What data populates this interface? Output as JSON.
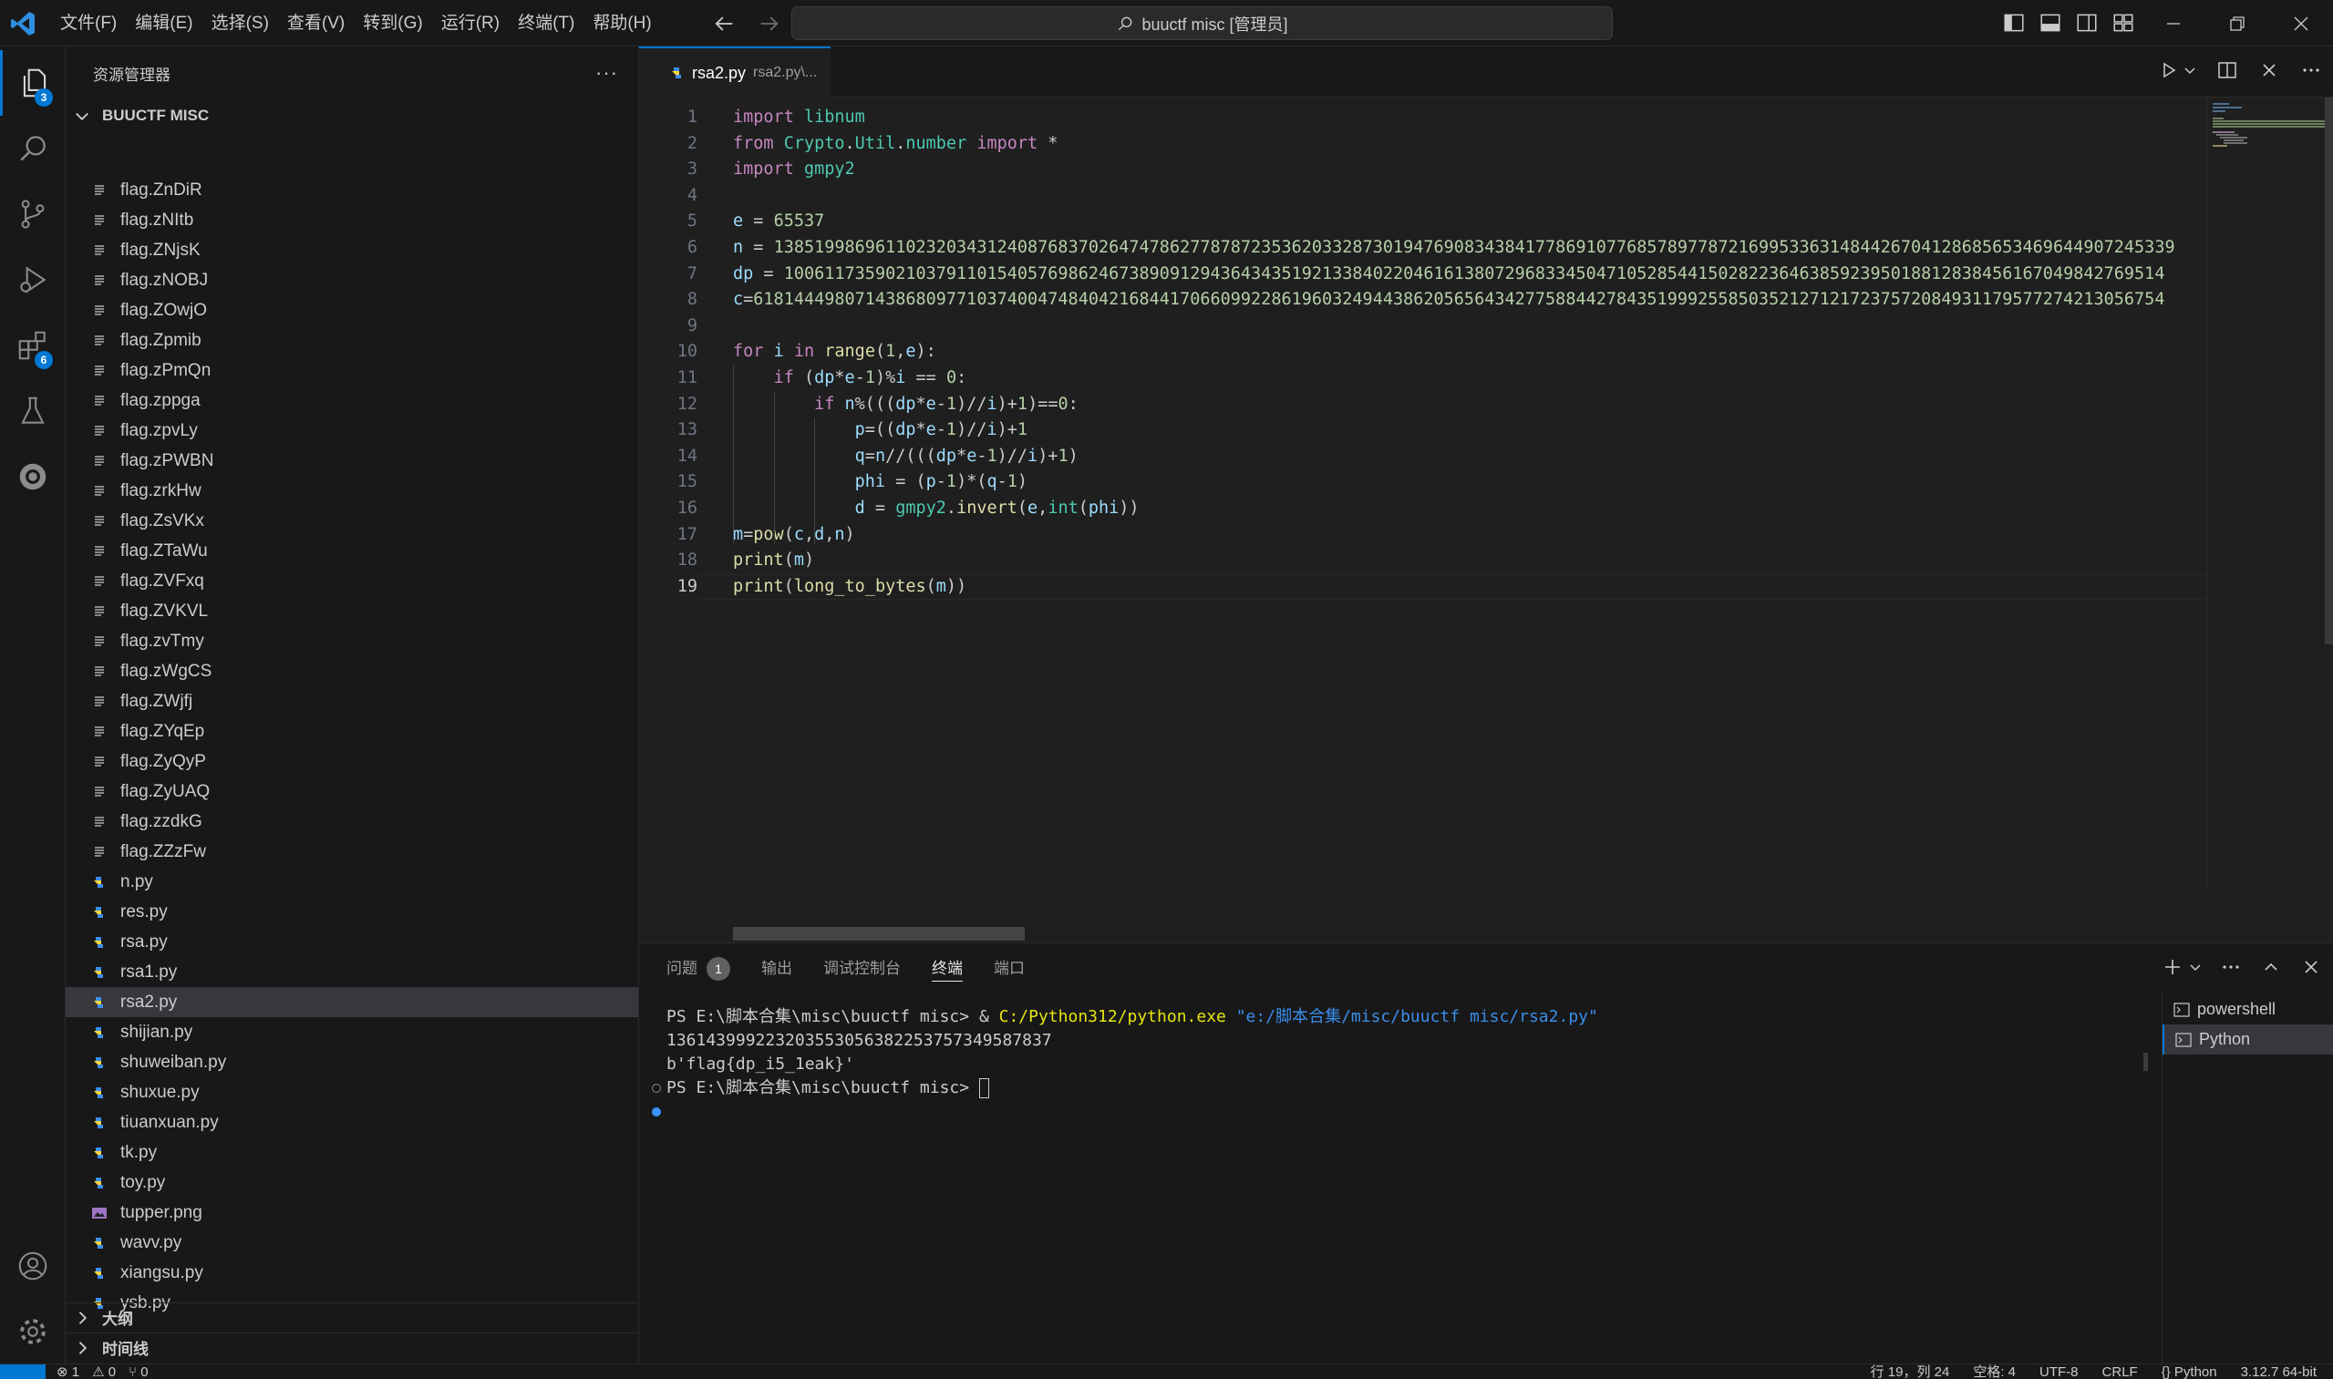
{
  "titlebar": {
    "menu": [
      "文件(F)",
      "编辑(E)",
      "选择(S)",
      "查看(V)",
      "转到(G)",
      "运行(R)",
      "终端(T)",
      "帮助(H)"
    ],
    "search_text": "buuctf misc [管理员]"
  },
  "activity": {
    "explorer_badge": "3",
    "extensions_badge": "6"
  },
  "sidebar": {
    "title": "资源管理器",
    "more": "···",
    "folder": "BUUCTF MISC",
    "files": [
      {
        "name": "flag.ZnDiR",
        "icon": "text-file-icon"
      },
      {
        "name": "flag.zNItb",
        "icon": "text-file-icon"
      },
      {
        "name": "flag.ZNjsK",
        "icon": "text-file-icon"
      },
      {
        "name": "flag.zNOBJ",
        "icon": "text-file-icon"
      },
      {
        "name": "flag.ZOwjO",
        "icon": "text-file-icon"
      },
      {
        "name": "flag.Zpmib",
        "icon": "text-file-icon"
      },
      {
        "name": "flag.zPmQn",
        "icon": "text-file-icon"
      },
      {
        "name": "flag.zppga",
        "icon": "text-file-icon"
      },
      {
        "name": "flag.zpvLy",
        "icon": "text-file-icon"
      },
      {
        "name": "flag.zPWBN",
        "icon": "text-file-icon"
      },
      {
        "name": "flag.zrkHw",
        "icon": "text-file-icon"
      },
      {
        "name": "flag.ZsVKx",
        "icon": "text-file-icon"
      },
      {
        "name": "flag.ZTaWu",
        "icon": "text-file-icon"
      },
      {
        "name": "flag.ZVFxq",
        "icon": "text-file-icon"
      },
      {
        "name": "flag.ZVKVL",
        "icon": "text-file-icon"
      },
      {
        "name": "flag.zvTmy",
        "icon": "text-file-icon"
      },
      {
        "name": "flag.zWgCS",
        "icon": "text-file-icon"
      },
      {
        "name": "flag.ZWjfj",
        "icon": "text-file-icon"
      },
      {
        "name": "flag.ZYqEp",
        "icon": "text-file-icon"
      },
      {
        "name": "flag.ZyQyP",
        "icon": "text-file-icon"
      },
      {
        "name": "flag.ZyUAQ",
        "icon": "text-file-icon"
      },
      {
        "name": "flag.zzdkG",
        "icon": "text-file-icon"
      },
      {
        "name": "flag.ZZzFw",
        "icon": "text-file-icon"
      },
      {
        "name": "n.py",
        "icon": "python-icon"
      },
      {
        "name": "res.py",
        "icon": "python-icon"
      },
      {
        "name": "rsa.py",
        "icon": "python-icon"
      },
      {
        "name": "rsa1.py",
        "icon": "python-icon"
      },
      {
        "name": "rsa2.py",
        "icon": "python-icon",
        "selected": true
      },
      {
        "name": "shijian.py",
        "icon": "python-icon"
      },
      {
        "name": "shuweiban.py",
        "icon": "python-icon"
      },
      {
        "name": "shuxue.py",
        "icon": "python-icon"
      },
      {
        "name": "tiuanxuan.py",
        "icon": "python-icon"
      },
      {
        "name": "tk.py",
        "icon": "python-icon"
      },
      {
        "name": "toy.py",
        "icon": "python-icon"
      },
      {
        "name": "tupper.png",
        "icon": "image-icon"
      },
      {
        "name": "wavv.py",
        "icon": "python-icon"
      },
      {
        "name": "xiangsu.py",
        "icon": "python-icon"
      },
      {
        "name": "ysb.py",
        "icon": "python-icon"
      }
    ],
    "outline": "大纲",
    "timeline": "时间线"
  },
  "editor": {
    "tab_label": "rsa2.py",
    "tab_desc": "rsa2.py\\...",
    "lines": [
      {
        "n": "1",
        "t": "import libnum"
      },
      {
        "n": "2",
        "t": "from Crypto.Util.number import *"
      },
      {
        "n": "3",
        "t": "import gmpy2"
      },
      {
        "n": "4",
        "t": ""
      },
      {
        "n": "5",
        "t": "e = 65537"
      },
      {
        "n": "6",
        "t": "n = 138519986961102320343124087683702647478627787872353620332873019476908343841778691077685789778721699533631484426704128685653469644907245339"
      },
      {
        "n": "7",
        "t": "dp = 1006117359021037911015405769862467389091294364343519213384022046161380729683345047105285441502822364638592395018812838456167049842769514"
      },
      {
        "n": "8",
        "t": "c=6181444980714386809771037400474840421684417066099228619603249443862056564342775884427843519992558503521271217237572084931179577274213056754"
      },
      {
        "n": "9",
        "t": ""
      },
      {
        "n": "10",
        "t": "for i in range(1,e):"
      },
      {
        "n": "11",
        "t": "    if (dp*e-1)%i == 0:"
      },
      {
        "n": "12",
        "t": "        if n%(((dp*e-1)//i)+1)==0:"
      },
      {
        "n": "13",
        "t": "            p=((dp*e-1)//i)+1"
      },
      {
        "n": "14",
        "t": "            q=n//(((dp*e-1)//i)+1)"
      },
      {
        "n": "15",
        "t": "            phi = (p-1)*(q-1)"
      },
      {
        "n": "16",
        "t": "            d = gmpy2.invert(e,int(phi))"
      },
      {
        "n": "17",
        "t": "m=pow(c,d,n)"
      },
      {
        "n": "18",
        "t": "print(m)"
      },
      {
        "n": "19",
        "t": "print(long_to_bytes(m))"
      }
    ]
  },
  "panel": {
    "tabs": [
      "问题",
      "输出",
      "调试控制台",
      "终端",
      "端口"
    ],
    "problems_count": "1",
    "terminal": {
      "prompt1": "PS E:\\脚本合集\\misc\\buuctf misc> ",
      "cmd_amp": "& ",
      "cmd_exe": "C:/Python312/python.exe",
      "cmd_arg": "\"e:/脚本合集/misc/buuctf misc/rsa2.py\"",
      "out1": "13614399922320355305638225375734958783​7",
      "out2": "b'flag{dp_i5_1eak}'",
      "prompt2": "PS E:\\脚本合集\\misc\\buuctf misc> "
    },
    "terminal_list": [
      "powershell",
      "Python"
    ]
  },
  "statusbar": {
    "left": [
      "⊗ 1",
      "⚠ 0",
      "⑂ 0"
    ],
    "right": [
      "行 19，列 24",
      "空格: 4",
      "UTF-8",
      "CRLF",
      "{} Python",
      "3.12.7 64-bit"
    ]
  }
}
